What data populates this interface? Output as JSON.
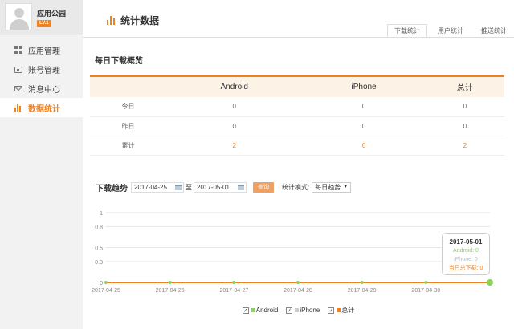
{
  "profile": {
    "name": "应用公园",
    "level": "LV.1"
  },
  "sidebar": {
    "items": [
      {
        "label": "应用管理",
        "icon": "grid-icon"
      },
      {
        "label": "账号管理",
        "icon": "card-icon"
      },
      {
        "label": "消息中心",
        "icon": "mail-icon"
      },
      {
        "label": "数据统计",
        "icon": "bar-chart-icon",
        "active": true
      }
    ]
  },
  "header": {
    "title": "统计数据"
  },
  "tabs": [
    {
      "label": "下载统计",
      "active": true
    },
    {
      "label": "用户统计"
    },
    {
      "label": "推送统计"
    }
  ],
  "overview": {
    "title": "每日下载概览",
    "columns": [
      "",
      "Android",
      "iPhone",
      "总计"
    ],
    "rows": [
      {
        "label": "今日",
        "android": "0",
        "iphone": "0",
        "total": "0"
      },
      {
        "label": "昨日",
        "android": "0",
        "iphone": "0",
        "total": "0"
      },
      {
        "label": "累计",
        "android": "2",
        "iphone": "0",
        "total": "2"
      }
    ]
  },
  "trend": {
    "title": "下载趋势",
    "start_date": "2017-04-25",
    "to_label": "至",
    "end_date": "2017-05-01",
    "query_label": "查询",
    "mode_label": "统计模式:",
    "mode_value": "每日趋势"
  },
  "chart_data": {
    "type": "line",
    "x": [
      "2017-04-25",
      "2017-04-26",
      "2017-04-27",
      "2017-04-28",
      "2017-04-29",
      "2017-04-30",
      "2017-05-01"
    ],
    "x_tick_labels": [
      "2017-04-25",
      "2017-04-26",
      "2017-04-27",
      "2017-04-28",
      "2017-04-29",
      "2017-04-30"
    ],
    "y_ticks": [
      "0",
      "0.3",
      "0.5",
      "0.8",
      "1"
    ],
    "ylim": [
      0,
      1
    ],
    "grid": true,
    "series": [
      {
        "name": "Android",
        "values": [
          0,
          0,
          0,
          0,
          0,
          0,
          0
        ],
        "color": "#8bd15b"
      },
      {
        "name": "iPhone",
        "values": [
          0,
          0,
          0,
          0,
          0,
          0,
          0
        ],
        "color": "#cccccc"
      },
      {
        "name": "总计",
        "values": [
          0,
          0,
          0,
          0,
          0,
          0,
          0
        ],
        "color": "#f0811f"
      }
    ],
    "legend_position": "bottom",
    "tooltip": {
      "date": "2017-05-01",
      "android": "Android: 0",
      "iphone": "iPhone: 0",
      "total": "当日总下载: 0"
    }
  },
  "colors": {
    "accent": "#f0811f",
    "android": "#8bd15b",
    "iphone": "#cccccc"
  }
}
